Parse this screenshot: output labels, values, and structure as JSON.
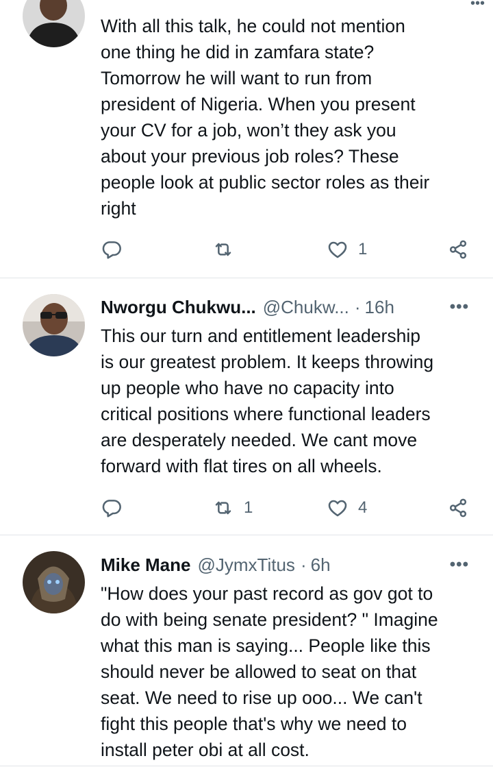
{
  "tweets": [
    {
      "name": "",
      "handle": "",
      "time": "",
      "text": "With all this talk, he could not mention\none thing he did in zamfara state?\nTomorrow he will want to run from\npresident of Nigeria. When you present\nyour CV for a job, won’t they ask you\nabout your previous job roles? These\npeople look at public sector roles as their\nright",
      "replies": "",
      "retweets": "",
      "likes": "1"
    },
    {
      "name": "Nworgu Chukwu...",
      "handle": "@Chukw...",
      "time": "16h",
      "text": "This our turn and entitlement leadership\nis our greatest problem. It keeps throwing\nup people who have no capacity into\ncritical positions where functional leaders\nare desperately needed. We cant move\nforward with flat tires on all wheels.",
      "replies": "",
      "retweets": "1",
      "likes": "4"
    },
    {
      "name": "Mike Mane",
      "handle": "@JymxTitus",
      "time": "6h",
      "text": "\"How does your past record as gov got to\ndo with being senate president? \"  Imagine\nwhat this man is saying... People like this\nshould never be allowed to seat on that\nseat. We need to rise up ooo... We can't\nfight this people that's why we need to\ninstall peter obi at all cost.",
      "replies": "",
      "retweets": "",
      "likes": ""
    }
  ],
  "icons": {
    "reply": "reply-icon",
    "retweet": "retweet-icon",
    "like": "heart-icon",
    "share": "share-icon",
    "more": "more-options-icon"
  },
  "colors": {
    "text": "#0f1419",
    "secondary": "#536471",
    "divider": "#e1e5e8"
  },
  "more_glyph": "•••"
}
